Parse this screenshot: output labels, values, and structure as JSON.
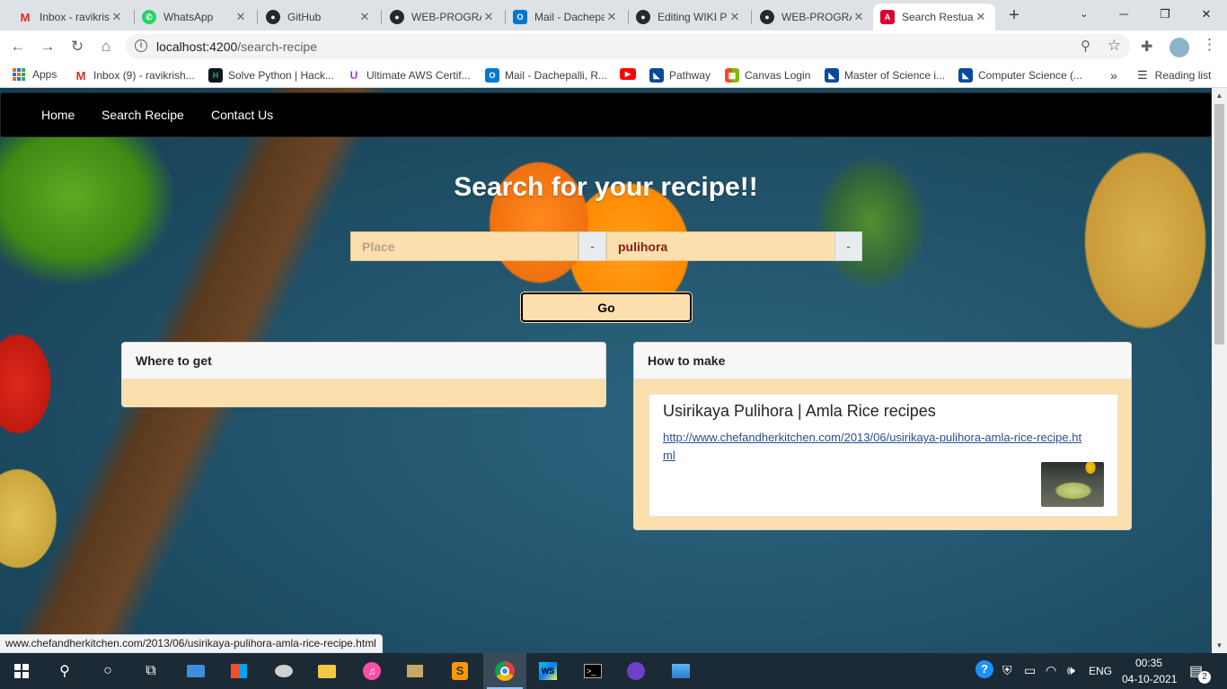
{
  "browser": {
    "tabs": [
      {
        "title": "Inbox - ravikrish",
        "icon": "gmail-icon",
        "color": "#d93025",
        "glyph": "M"
      },
      {
        "title": "WhatsApp",
        "icon": "whatsapp-icon",
        "color": "#25d366",
        "glyph": "✆"
      },
      {
        "title": "GitHub",
        "icon": "github-icon",
        "color": "#24292e",
        "glyph": "●"
      },
      {
        "title": "WEB-PROGRAMM",
        "icon": "github-icon",
        "color": "#24292e",
        "glyph": "●"
      },
      {
        "title": "Mail - Dachepalli",
        "icon": "outlook-icon",
        "color": "#0078d4",
        "glyph": "O"
      },
      {
        "title": "Editing WIKI P",
        "icon": "github-icon",
        "color": "#24292e",
        "glyph": "●"
      },
      {
        "title": "WEB-PROGRAMM",
        "icon": "github-icon",
        "color": "#24292e",
        "glyph": "●"
      },
      {
        "title": "Search Restuarant",
        "icon": "angular-icon",
        "color": "#dd0031",
        "glyph": "A"
      }
    ],
    "url_host": "localhost:4200",
    "url_path": "/search-recipe",
    "bookmarks": [
      {
        "label": "Apps",
        "icon": "apps-grid-icon",
        "color": "#1a73e8",
        "glyph": ""
      },
      {
        "label": "Inbox (9) - ravikrish...",
        "icon": "gmail-icon",
        "color": "#d93025",
        "glyph": "M"
      },
      {
        "label": "Solve Python | Hack...",
        "icon": "hackerrank-icon",
        "color": "#1ba94c",
        "glyph": "H"
      },
      {
        "label": "Ultimate AWS Certif...",
        "icon": "udemy-icon",
        "color": "#a435f0",
        "glyph": "U"
      },
      {
        "label": "Mail - Dachepalli, R...",
        "icon": "outlook-icon",
        "color": "#0078d4",
        "glyph": "O"
      },
      {
        "label": "",
        "icon": "youtube-icon",
        "color": "#ff0000",
        "glyph": "▶"
      },
      {
        "label": "Pathway",
        "icon": "university-icon",
        "color": "#0a4a9c",
        "glyph": "◣"
      },
      {
        "label": "Canvas Login",
        "icon": "microsoft-icon",
        "color": "#f25022",
        "glyph": "▦"
      },
      {
        "label": "Master of Science i...",
        "icon": "university-icon",
        "color": "#0a4a9c",
        "glyph": "◣"
      },
      {
        "label": "Computer Science (...",
        "icon": "university-icon",
        "color": "#0a4a9c",
        "glyph": "◣"
      }
    ],
    "more_bookmarks": "»",
    "reading_list": "Reading list",
    "status_url": "www.chefandherkitchen.com/2013/06/usirikaya-pulihora-amla-rice-recipe.html"
  },
  "app": {
    "nav": {
      "home": "Home",
      "search": "Search Recipe",
      "contact": "Contact Us"
    },
    "hero_title": "Search for your recipe!!",
    "place_placeholder": "Place",
    "recipe_value": "pulihora",
    "addon_symbol": "-",
    "go_label": "Go",
    "where_title": "Where to get",
    "how_title": "How to make",
    "result": {
      "title": "Usirikaya Pulihora | Amla Rice recipes",
      "link": "http://www.chefandherkitchen.com/2013/06/usirikaya-pulihora-amla-rice-recipe.html"
    }
  },
  "taskbar": {
    "language": "ENG",
    "time": "00:35",
    "date": "04-10-2021",
    "notifications": "2"
  }
}
